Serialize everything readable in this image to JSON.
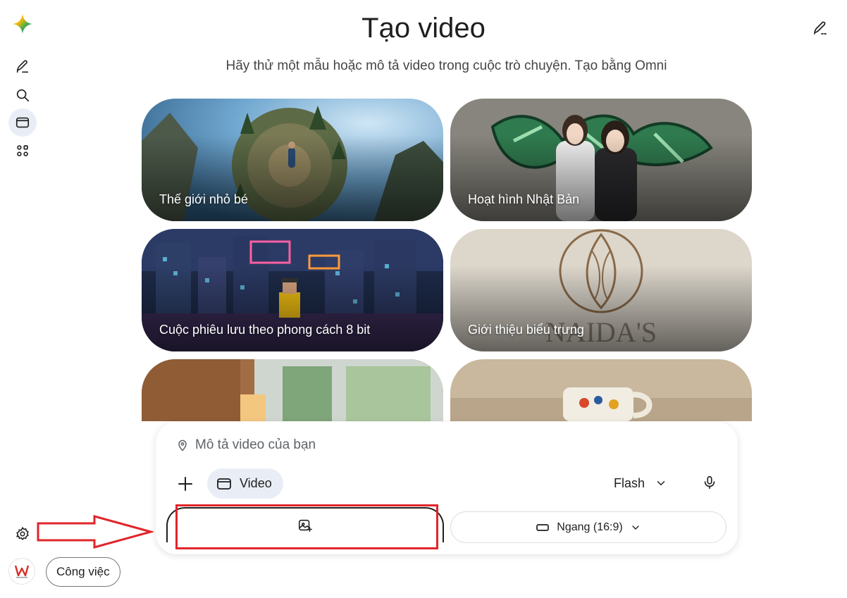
{
  "header": {
    "title": "Tạo video",
    "subtitle": "Hãy thử một mẫu hoặc mô tả video trong cuộc trò chuyện. Tạo bằng Omni"
  },
  "sidebar": {
    "icons": [
      "gemini-spark-icon",
      "new-chat-icon",
      "search-icon",
      "video-icon",
      "apps-icon",
      "settings-icon"
    ],
    "work_label": "Công việc"
  },
  "cards": [
    {
      "label": "Thế giới nhỏ bé"
    },
    {
      "label": "Hoạt hình Nhật Bản"
    },
    {
      "label": "Cuộc phiêu lưu theo phong cách 8 bit"
    },
    {
      "label": "Giới thiệu biểu trưng"
    },
    {
      "label": ""
    },
    {
      "label": ""
    }
  ],
  "composer": {
    "placeholder": "Mô tả video của bạn",
    "video_chip": "Video",
    "model": "Flash",
    "aspect_ratio": "Ngang (16:9)"
  },
  "colors": {
    "accent_chip": "#e9eef6",
    "annotation_red": "#e0262b"
  }
}
